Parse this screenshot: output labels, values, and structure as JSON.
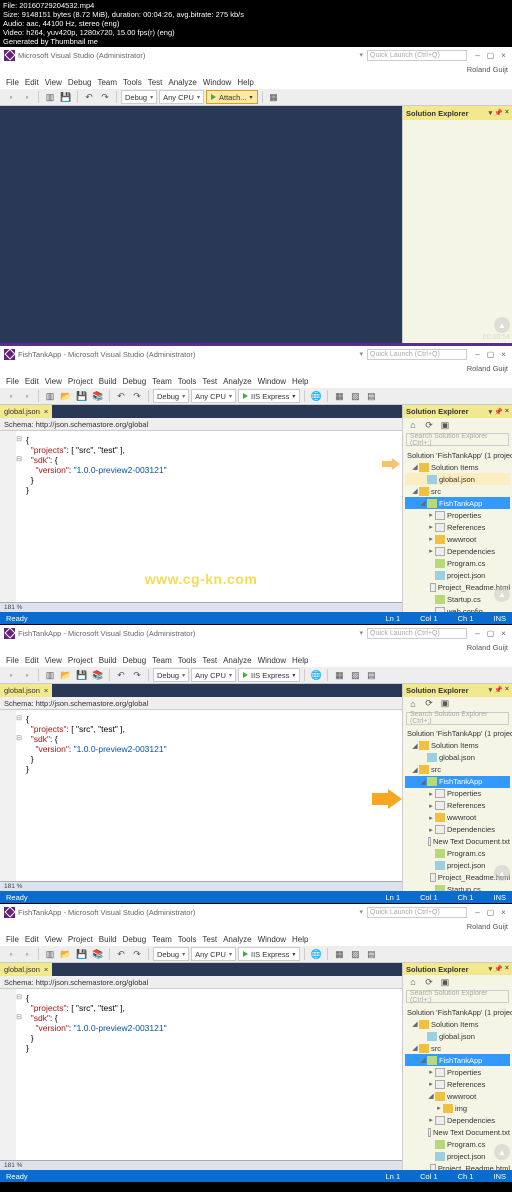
{
  "meta_overlay": {
    "line1": "File: 20160729204532.mp4",
    "line2": "Size: 9148151 bytes (8.72 MiB), duration: 00:04:26, avg.bitrate: 275 kb/s",
    "line3": "Audio: aac, 44100 Hz, stereo (eng)",
    "line4": "Video: h264, yuv420p, 1280x720, 15.00 fps(r) (eng)",
    "line5": "Generated by Thumbnail me"
  },
  "vs": {
    "title1": "Microsoft Visual Studio (Administrator)",
    "title2": "FishTankApp - Microsoft Visual Studio (Administrator)",
    "quick_launch": "Quick Launch (Ctrl+Q)",
    "user": "Roland Guijt"
  },
  "menu": {
    "file": "File",
    "edit": "Edit",
    "view": "View",
    "project": "Project",
    "build": "Build",
    "debug": "Debug",
    "team": "Team",
    "tools": "Tools",
    "test": "Test",
    "analyze": "Analyze",
    "window": "Window",
    "help": "Help"
  },
  "toolbar": {
    "debug": "Debug",
    "anycpu": "Any CPU",
    "attach": "Attach...",
    "iis": "IIS Express"
  },
  "tab": {
    "name": "global.json",
    "close": "×"
  },
  "schema": {
    "label": "Schema:",
    "url": "http://json.schemastore.org/global"
  },
  "code": {
    "projects_key": "\"projects\"",
    "projects_val": ": [ \"src\", \"test\" ],",
    "sdk_key": "\"sdk\"",
    "sdk_val": ": {",
    "ver_key": "    \"version\"",
    "ver_val": ": \"1.0.0-preview2-003121\"",
    "close1": "  }",
    "close2": "}"
  },
  "watermark": "www.cg-kn.com",
  "status": {
    "ready": "Ready",
    "ln": "Ln 1",
    "col": "Col 1",
    "ch": "Ch 1",
    "ins": "INS"
  },
  "se": {
    "title": "Solution Explorer",
    "search": "Search Solution Explorer (Ctrl+;)",
    "solution": "Solution 'FishTankApp' (1 project)",
    "solution_items": "Solution Items",
    "global": "global.json",
    "src": "src",
    "app": "FishTankApp",
    "properties": "Properties",
    "references": "References",
    "wwwroot": "wwwroot",
    "dependencies": "Dependencies",
    "programcs": "Program.cs",
    "projectjson": "project.json",
    "readme": "Project_Readme.html",
    "startup": "Startup.cs",
    "webconfig": "web.config",
    "newtxt": "New Text Document.txt",
    "img": "img"
  },
  "bottomtool": {
    "pct": "181 %"
  },
  "timestamp": "00:00:54"
}
